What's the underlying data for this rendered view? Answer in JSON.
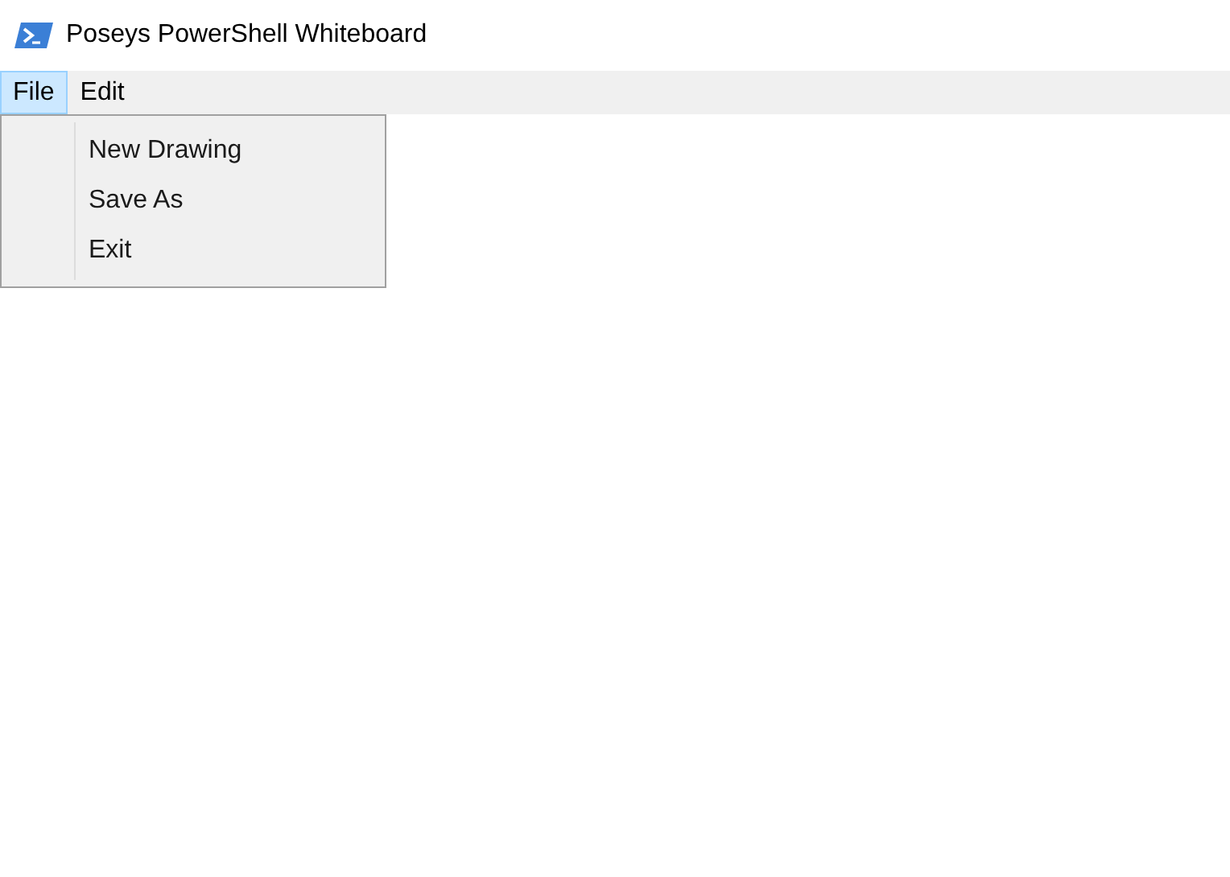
{
  "window": {
    "title": "Poseys PowerShell Whiteboard"
  },
  "menu_bar": [
    {
      "label": "File",
      "selected": true
    },
    {
      "label": "Edit",
      "selected": false
    }
  ],
  "dropdown": {
    "items": [
      "New Drawing",
      "Save As",
      "Exit"
    ]
  }
}
